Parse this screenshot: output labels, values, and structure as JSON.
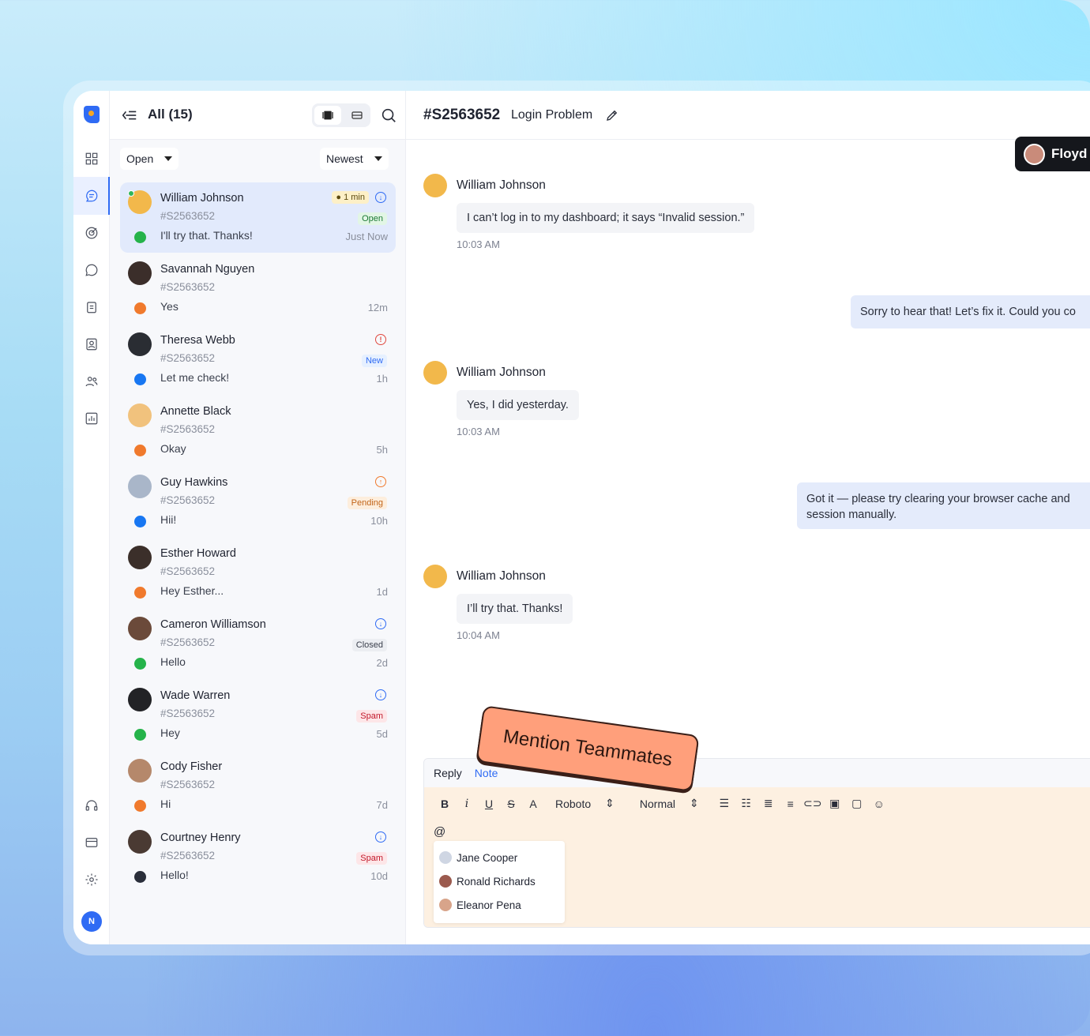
{
  "sidebar": {
    "icons": [
      "logo-icon",
      "dashboard-icon",
      "chat-icon",
      "analytics-icon",
      "whatsapp-icon",
      "clipboard-icon",
      "contact-icon",
      "users-icon",
      "report-icon",
      "headset-icon",
      "billing-icon",
      "settings-icon"
    ],
    "user_initial": "N"
  },
  "list": {
    "title": "All (15)",
    "status_filter": "Open",
    "sort": "Newest",
    "conversations": [
      {
        "name": "William Johnson",
        "ticket": "#S2563652",
        "message": "I'll try that. Thanks!",
        "time": "Just Now",
        "badge": "Open",
        "timer": "1 min",
        "channel": "whatsapp",
        "avatar_color": "#f2b84b"
      },
      {
        "name": "Savannah Nguyen",
        "ticket": "#S2563652",
        "message": "Yes",
        "time": "12m",
        "badge": "",
        "channel": "chat",
        "avatar_color": "#3b2e2a"
      },
      {
        "name": "Theresa Webb",
        "ticket": "#S2563652",
        "message": "Let me check!",
        "time": "1h",
        "badge": "New",
        "channel": "facebook",
        "avatar_color": "#2a2d33"
      },
      {
        "name": "Annette Black",
        "ticket": "#S2563652",
        "message": "Okay",
        "time": "5h",
        "badge": "",
        "channel": "chat",
        "avatar_color": "#f1c27d"
      },
      {
        "name": "Guy Hawkins",
        "ticket": "#S2563652",
        "message": "Hii!",
        "time": "10h",
        "badge": "Pending",
        "channel": "facebook",
        "avatar_color": "#a9b6c9"
      },
      {
        "name": "Esther Howard",
        "ticket": "#S2563652",
        "message": "Hey Esther...",
        "time": "1d",
        "badge": "",
        "channel": "chat",
        "avatar_color": "#3b2f2a"
      },
      {
        "name": "Cameron Williamson",
        "ticket": "#S2563652",
        "message": "Hello",
        "time": "2d",
        "badge": "Closed",
        "channel": "whatsapp",
        "avatar_color": "#6b4a3a"
      },
      {
        "name": "Wade Warren",
        "ticket": "#S2563652",
        "message": "Hey",
        "time": "5d",
        "badge": "Spam",
        "channel": "whatsapp",
        "avatar_color": "#222326"
      },
      {
        "name": "Cody Fisher",
        "ticket": "#S2563652",
        "message": "Hi",
        "time": "7d",
        "badge": "",
        "channel": "chat",
        "avatar_color": "#b5886b"
      },
      {
        "name": "Courtney Henry",
        "ticket": "#S2563652",
        "message": "Hello!",
        "time": "10d",
        "badge": "Spam",
        "channel": "email",
        "avatar_color": "#4a3a33"
      }
    ]
  },
  "chat": {
    "ticket_id": "#S2563652",
    "subject": "Login Problem",
    "agent": "Floyd I",
    "messages": [
      {
        "from": "William Johnson",
        "text": "I can’t log in to my dashboard; it says “Invalid session.”",
        "time": "10:03 AM"
      },
      {
        "from": "agent",
        "text": "Sorry to hear that! Let’s fix it. Could you co"
      },
      {
        "from": "William Johnson",
        "text": "Yes, I did yesterday.",
        "time": "10:03 AM"
      },
      {
        "from": "agent",
        "text": "Got it — please try clearing your browser cache and",
        "text2": "session manually."
      },
      {
        "from": "William Johnson",
        "text": "I’ll try that. Thanks!",
        "time": "10:04 AM"
      }
    ]
  },
  "composer": {
    "tab_reply": "Reply",
    "tab_note": "Note",
    "font": "Roboto",
    "style": "Normal",
    "at_symbol": "@",
    "mentions": [
      "Jane Cooper",
      "Ronald Richards",
      "Eleanor Pena"
    ]
  },
  "sticker": "Mention Teammates",
  "colors": {
    "accent": "#2f6bf4",
    "selected_row": "#e2eafc",
    "note_bg": "#fdf0e1",
    "sticker": "#ff9f7b"
  }
}
